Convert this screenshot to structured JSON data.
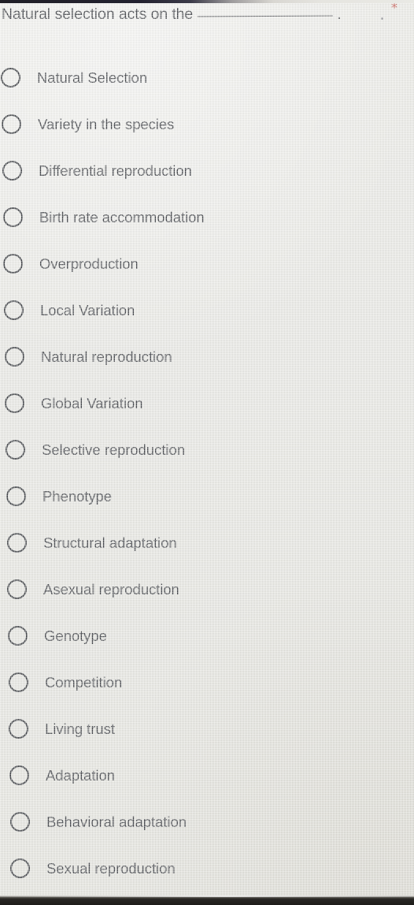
{
  "question": {
    "prefix": "Natural selection acts on the",
    "blank": "__________",
    "period": ".",
    "required_marker": "*"
  },
  "options": [
    {
      "label": "Natural Selection",
      "selected": false
    },
    {
      "label": "Variety in the species",
      "selected": false
    },
    {
      "label": "Differential reproduction",
      "selected": false
    },
    {
      "label": "Birth rate accommodation",
      "selected": false
    },
    {
      "label": "Overproduction",
      "selected": false
    },
    {
      "label": "Local Variation",
      "selected": false
    },
    {
      "label": "Natural reproduction",
      "selected": false
    },
    {
      "label": "Global Variation",
      "selected": false
    },
    {
      "label": "Selective reproduction",
      "selected": false
    },
    {
      "label": "Phenotype",
      "selected": false
    },
    {
      "label": "Structural adaptation",
      "selected": false
    },
    {
      "label": "Asexual reproduction",
      "selected": false
    },
    {
      "label": "Genotype",
      "selected": false
    },
    {
      "label": "Competition",
      "selected": false
    },
    {
      "label": "Living trust",
      "selected": false
    },
    {
      "label": "Adaptation",
      "selected": false
    },
    {
      "label": "Behavioral adaptation",
      "selected": false
    },
    {
      "label": "Sexual reproduction",
      "selected": false
    }
  ],
  "colors": {
    "background": "#e9e9e4",
    "text": "#35383d",
    "required_star": "#c0453c",
    "radio_border": "#2e3136",
    "bezel": "#1e1c1a"
  }
}
